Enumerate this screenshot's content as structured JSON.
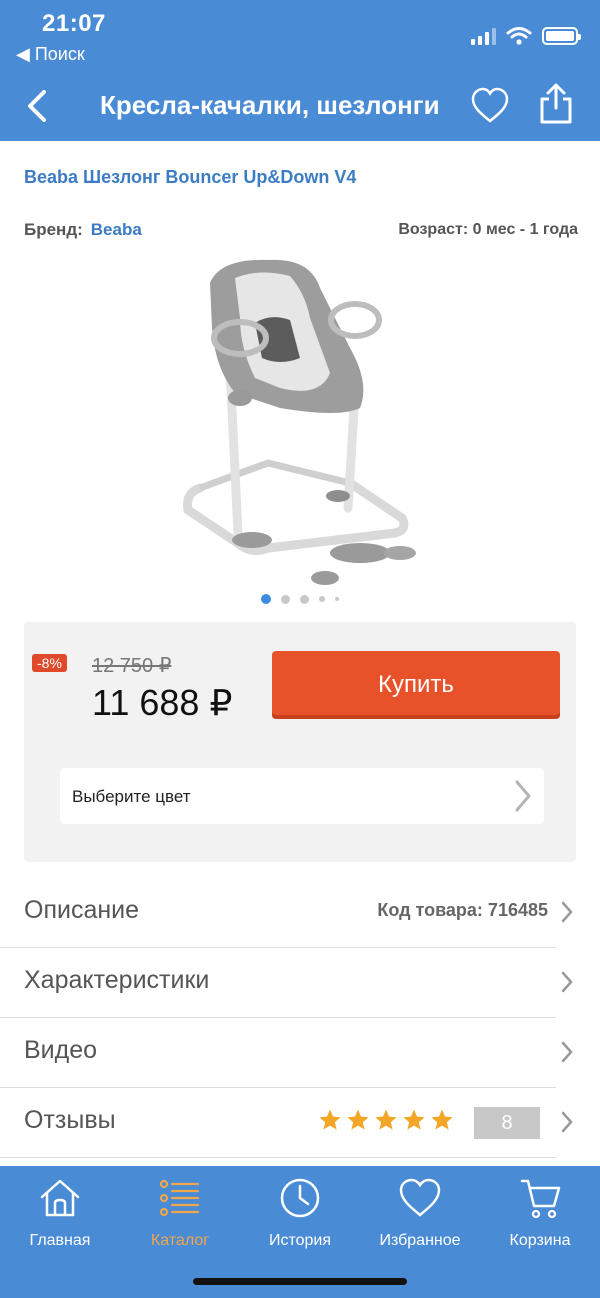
{
  "status_bar": {
    "time": "21:07",
    "back_label": "◀ Поиск"
  },
  "header": {
    "title": "Кресла-качалки, шезлонги",
    "back_icon": "chevron-left-icon",
    "favorite_icon": "heart-icon",
    "share_icon": "share-icon"
  },
  "product": {
    "title": "Beaba Шезлонг Bouncer Up&Down V4",
    "brand_label": "Бренд:",
    "brand_value": "Beaba",
    "age_label": "Возраст: 0 мес - 1 года",
    "image_count": 5,
    "active_image": 1
  },
  "price": {
    "discount": "-8%",
    "old_price": "12 750 ₽",
    "new_price": "11 688 ₽",
    "buy_label": "Купить",
    "color_select_label": "Выберите цвет"
  },
  "rows": {
    "description": "Описание",
    "product_code": "Код товара: 716485",
    "characteristics": "Характеристики",
    "video": "Видео",
    "reviews": "Отзывы",
    "rating_stars": 5,
    "review_count": "8"
  },
  "nav": {
    "items": [
      {
        "label": "Главная",
        "icon": "home-icon"
      },
      {
        "label": "Каталог",
        "icon": "catalog-icon"
      },
      {
        "label": "История",
        "icon": "clock-icon"
      },
      {
        "label": "Избранное",
        "icon": "heart-icon"
      },
      {
        "label": "Корзина",
        "icon": "cart-icon"
      }
    ],
    "active_index": 1
  },
  "colors": {
    "header_bg": "#4a8bd6",
    "accent_blue": "#3c7cc4",
    "buy_button": "#e8522a",
    "discount_badge": "#e04a2b",
    "active_nav": "#f0a64a",
    "star": "#f2a626"
  }
}
